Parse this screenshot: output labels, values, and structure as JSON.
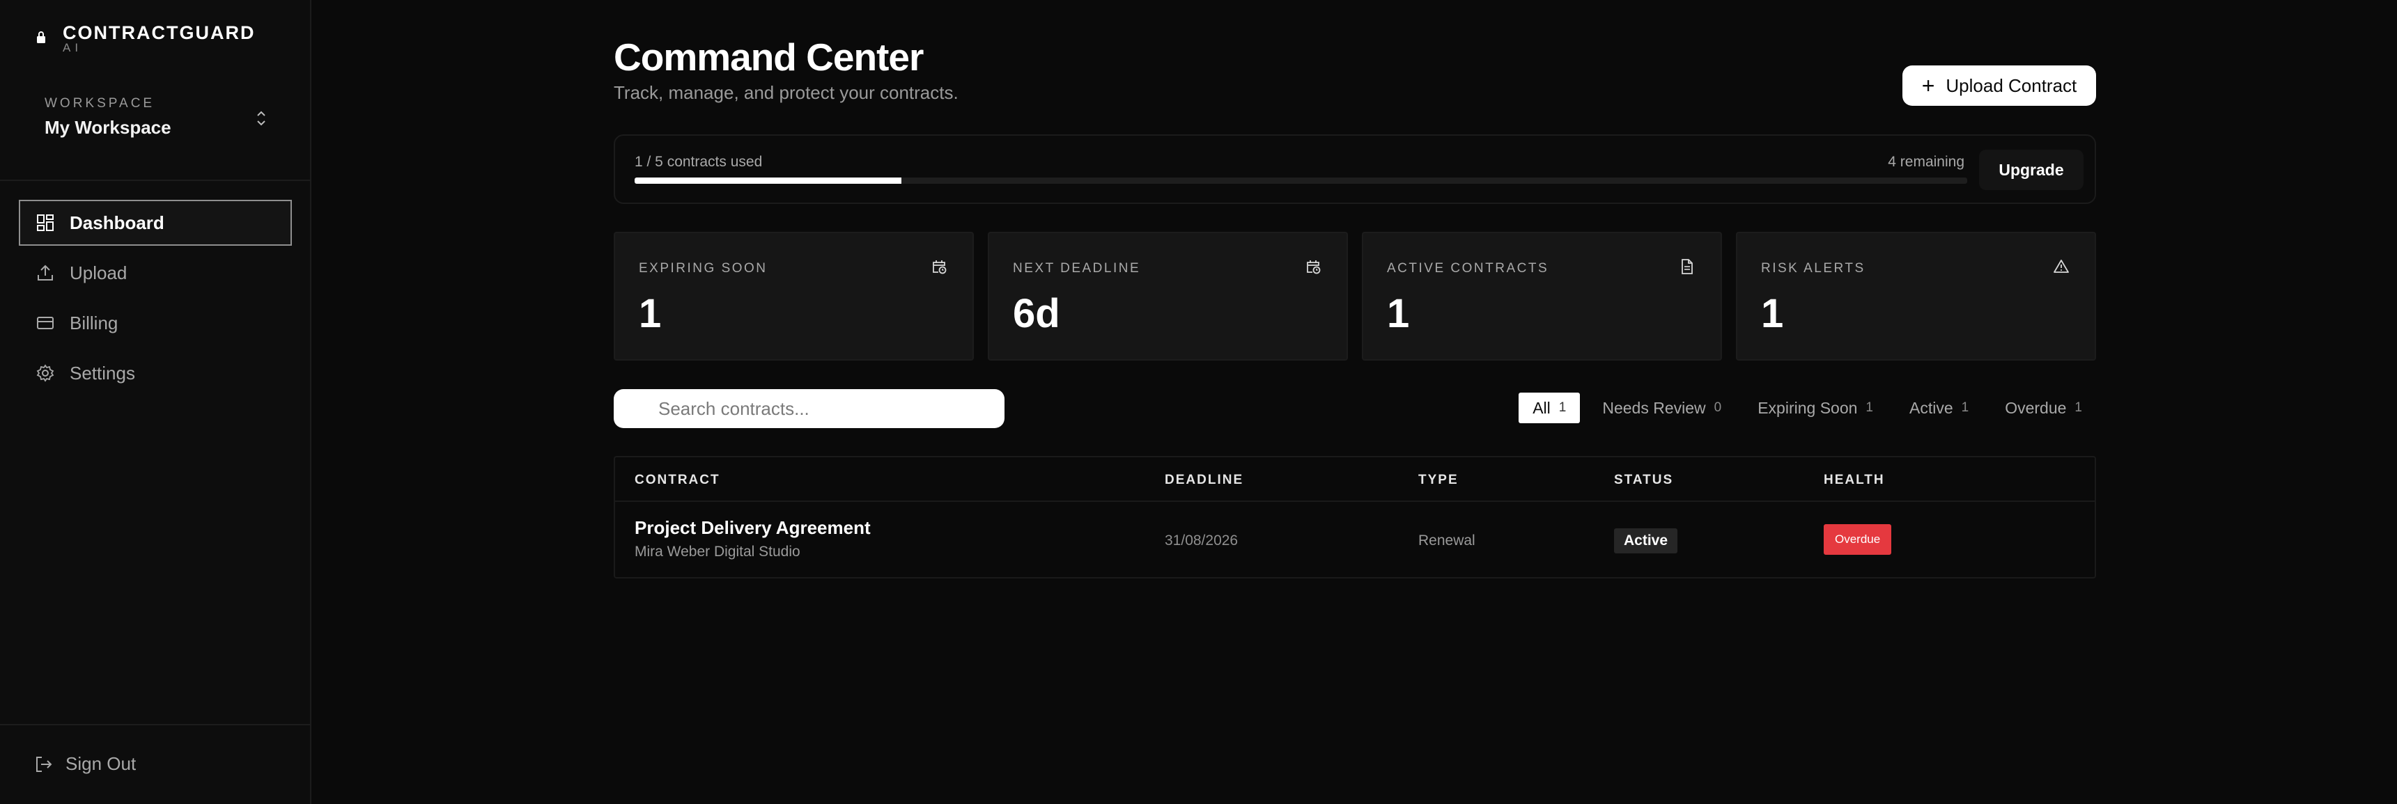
{
  "brand": {
    "name": "CONTRACTGUARD",
    "sub": "AI"
  },
  "workspace": {
    "label": "WORKSPACE",
    "name": "My Workspace"
  },
  "nav": [
    {
      "label": "Dashboard",
      "icon": "dashboard-icon",
      "active": true
    },
    {
      "label": "Upload",
      "icon": "upload-icon"
    },
    {
      "label": "Billing",
      "icon": "credit-card-icon"
    },
    {
      "label": "Settings",
      "icon": "gear-icon"
    }
  ],
  "signout": {
    "label": "Sign Out"
  },
  "header": {
    "title": "Command Center",
    "subtitle": "Track, manage, and protect your contracts.",
    "upload_label": "Upload Contract"
  },
  "usage": {
    "label": "1 / 5 contracts used",
    "remaining": "4 remaining",
    "fraction": 0.2,
    "upgrade_label": "Upgrade"
  },
  "stats": [
    {
      "label": "EXPIRING SOON",
      "value": "1",
      "icon": "calendar-clock-icon"
    },
    {
      "label": "NEXT DEADLINE",
      "value": "6d",
      "icon": "calendar-clock-icon"
    },
    {
      "label": "ACTIVE CONTRACTS",
      "value": "1",
      "icon": "document-icon"
    },
    {
      "label": "RISK ALERTS",
      "value": "1",
      "icon": "warning-icon"
    }
  ],
  "search": {
    "placeholder": "Search contracts..."
  },
  "filters": [
    {
      "label": "All",
      "count": "1",
      "active": true
    },
    {
      "label": "Needs Review",
      "count": "0"
    },
    {
      "label": "Expiring Soon",
      "count": "1"
    },
    {
      "label": "Active",
      "count": "1"
    },
    {
      "label": "Overdue",
      "count": "1"
    }
  ],
  "table": {
    "headers": [
      "CONTRACT",
      "DEADLINE",
      "TYPE",
      "STATUS",
      "HEALTH"
    ],
    "rows": [
      {
        "name": "Project Delivery Agreement",
        "party": "Mira Weber Digital Studio",
        "deadline": "31/08/2026",
        "type": "Renewal",
        "status": "Active",
        "health": "Overdue"
      }
    ]
  },
  "colors": {
    "background": "#0a0a0a",
    "danger": "#e5393f",
    "accent": "#ffffff"
  }
}
